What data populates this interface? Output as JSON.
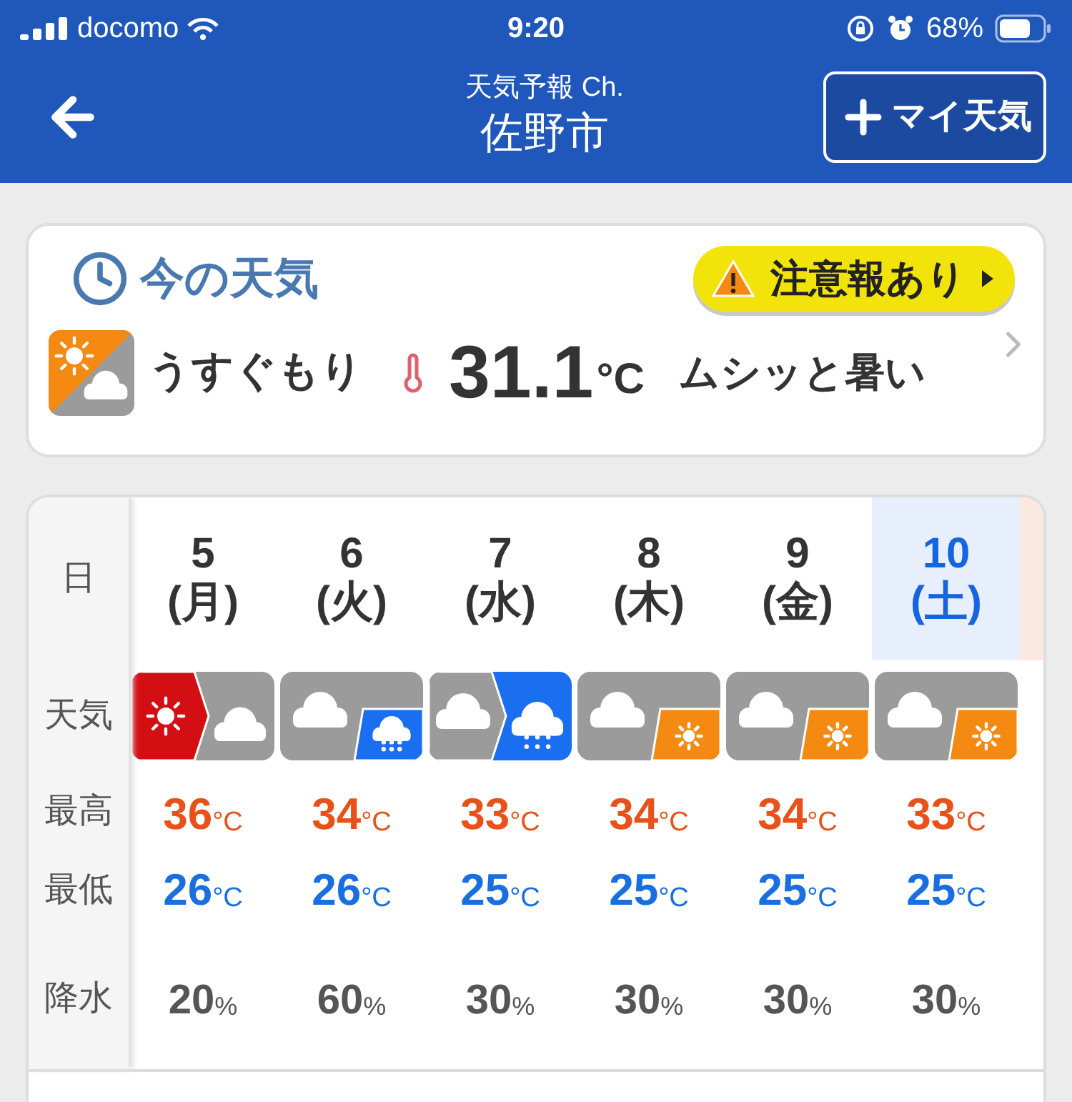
{
  "status_bar": {
    "carrier": "docomo",
    "time": "9:20",
    "battery": "68%"
  },
  "header": {
    "subtitle": "天気予報 Ch.",
    "title": "佐野市",
    "add_button": "マイ天気"
  },
  "current": {
    "title": "今の天気",
    "alert": "注意報あり",
    "condition": "うすぐもり",
    "temperature": "31.1",
    "unit": "°C",
    "feel": "ムシッと暑い"
  },
  "forecast": {
    "labels": {
      "date": "日",
      "weather": "天気",
      "high": "最高",
      "low": "最低",
      "precip": "降水"
    },
    "days": [
      {
        "day": "5",
        "weekday": "(月)",
        "kind": "weekday",
        "icon": {
          "kind": "then",
          "parts": [
            {
              "kind": "hot"
            },
            {
              "kind": "cloudy"
            }
          ]
        },
        "high": "36",
        "high_unit": "°C",
        "low": "26",
        "low_unit": "°C",
        "precip": "20",
        "precip_unit": "%"
      },
      {
        "day": "6",
        "weekday": "(火)",
        "kind": "weekday",
        "icon": {
          "kind": "sometimes",
          "parts": [
            {
              "kind": "cloudy"
            },
            {
              "kind": "rain"
            }
          ]
        },
        "high": "34",
        "high_unit": "°C",
        "low": "26",
        "low_unit": "°C",
        "precip": "60",
        "precip_unit": "%"
      },
      {
        "day": "7",
        "weekday": "(水)",
        "kind": "weekday",
        "icon": {
          "kind": "then",
          "parts": [
            {
              "kind": "cloudy"
            },
            {
              "kind": "rain"
            }
          ]
        },
        "high": "33",
        "high_unit": "°C",
        "low": "25",
        "low_unit": "°C",
        "precip": "30",
        "precip_unit": "%"
      },
      {
        "day": "8",
        "weekday": "(木)",
        "kind": "weekday",
        "icon": {
          "kind": "sometimes",
          "parts": [
            {
              "kind": "cloudy"
            },
            {
              "kind": "sunny"
            }
          ]
        },
        "high": "34",
        "high_unit": "°C",
        "low": "25",
        "low_unit": "°C",
        "precip": "30",
        "precip_unit": "%"
      },
      {
        "day": "9",
        "weekday": "(金)",
        "kind": "weekday",
        "icon": {
          "kind": "sometimes",
          "parts": [
            {
              "kind": "cloudy"
            },
            {
              "kind": "sunny"
            }
          ]
        },
        "high": "34",
        "high_unit": "°C",
        "low": "25",
        "low_unit": "°C",
        "precip": "30",
        "precip_unit": "%"
      },
      {
        "day": "10",
        "weekday": "(土)",
        "kind": "saturday",
        "icon": {
          "kind": "sometimes",
          "parts": [
            {
              "kind": "cloudy"
            },
            {
              "kind": "sunny"
            }
          ]
        },
        "high": "33",
        "high_unit": "°C",
        "low": "25",
        "low_unit": "°C",
        "precip": "30",
        "precip_unit": "%"
      }
    ]
  }
}
